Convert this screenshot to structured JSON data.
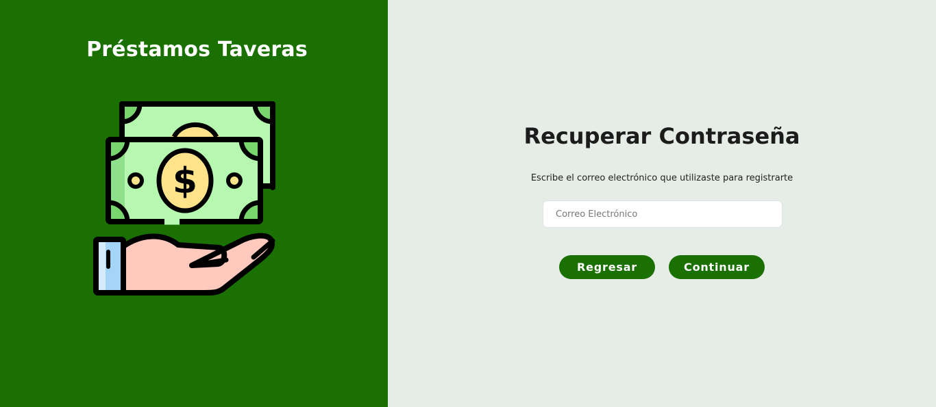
{
  "brand": {
    "title": "Préstamos Taveras",
    "illustration_icon": "money-hand-icon"
  },
  "form": {
    "title": "Recuperar Contraseña",
    "subtitle": "Escribe el correo electrónico que utilizaste para registrarte",
    "email_placeholder": "Correo Electrónico",
    "email_value": "",
    "back_label": "Regresar",
    "continue_label": "Continuar"
  },
  "colors": {
    "brand_green": "#1a7000",
    "background_right": "#e6ece6",
    "bill_green": "#b7f8b0",
    "coin_yellow": "#ffe38a",
    "hand_skin": "#ffc9bd",
    "cuff_blue": "#a4d4f7"
  }
}
